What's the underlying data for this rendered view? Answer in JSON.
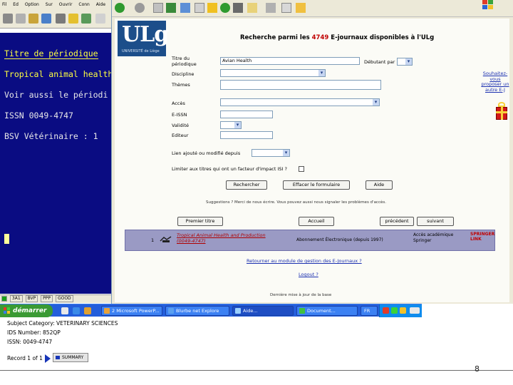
{
  "terminal": {
    "menu": [
      "Fil",
      "Ed",
      "Option",
      "Sur",
      "Ouvrir",
      "Conn",
      "Aide"
    ],
    "lines": [
      {
        "text": "Titre de périodique",
        "color": "yellow"
      },
      {
        "text": "Tropical animal health",
        "color": "yellow"
      },
      {
        "text": "Voir aussi le périodi",
        "color": "white"
      },
      {
        "text": "ISSN 0049-4747",
        "color": "white"
      },
      {
        "text": "BSV   Vétérinaire : 1",
        "color": "white"
      }
    ],
    "status_items": [
      "3A1",
      "BVP",
      "PPP",
      "GOOD"
    ]
  },
  "browser": {
    "logo": "ULg",
    "logo_subtitle": "UNIVERSITÉ de Liège",
    "title_prefix": "Recherche parmi les",
    "title_count": "4749",
    "title_suffix": "E-journaux disponibles à l'ULg",
    "form": {
      "title_label": "Titre du périodique",
      "title_value": "Avian Health",
      "title_mode": "Débutant par",
      "discipline_label": "Discipline",
      "themes_label": "Thèmes",
      "acces_label": "Accès",
      "eissn_label": "E-ISSN",
      "validite_label": "Validité",
      "editeur_label": "Editeur",
      "modified_label": "Lien ajouté ou modifié depuis",
      "impact_label": "Limiter aux titres qui ont un facteur d'impact ISI ?"
    },
    "buttons": {
      "search": "Rechercher",
      "clear": "Effacer le formulaire",
      "help": "Aide"
    },
    "note": "Suggestions ? Merci de nous écrire. Vous pouvez aussi nous signaler les problèmes d'accès.",
    "side_link": "Souhaitez-vous proposer un autre E-J",
    "nav": {
      "first": "Premier titre",
      "home": "Accueil",
      "prev": "précédent",
      "next": "suivant"
    },
    "result": {
      "number": "1",
      "title_line1": "Tropical Animal Health and Production",
      "title_line2": "(0049-4747)",
      "access": "Abonnement Électronique (depuis 1997)",
      "access_right_line1": "Accès académique",
      "access_right_line2": "Springer",
      "provider_line1": "SPRINGER",
      "provider_line2": "LINK"
    },
    "back_link": "Retourner au module de gestion des E-Journaux ?",
    "logout_link": "Logout ?",
    "footer_note": "Dernière mise à jour de la base"
  },
  "taskbar": {
    "start": "démarrer",
    "tasks": [
      "2 Microsoft PowerP...",
      "Blurbe net Explore",
      "Aide...",
      "Document..."
    ],
    "tray_label": "FR"
  },
  "record": {
    "subject": "Subject Category: VETERINARY SCIENCES",
    "ids": "IDS Number: 852QP",
    "issn": "ISSN: 0049-4747",
    "nav_text": "Record 1 of 1",
    "summary": "SUMMARY"
  },
  "slide_number": "8",
  "colors": {
    "terminal_bg": "#0a0c82",
    "terminal_highlight": "#ffff40",
    "logo_bg": "#1c4e8a",
    "result_bg": "#9a9ac4",
    "taskbar": "#245edb",
    "start": "#3a9a34"
  }
}
